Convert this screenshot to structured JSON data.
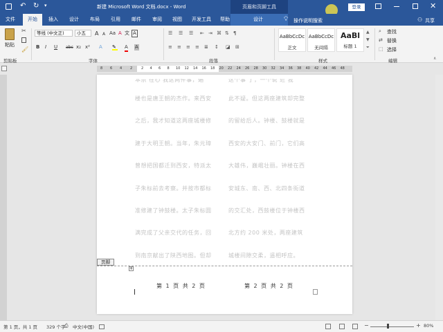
{
  "title_bar": {
    "doc_title": "新建 Microsoft Word 文档.docx  -  Word",
    "context_title": "页眉和页脚工具",
    "login_label": "登录",
    "icons": [
      "save-icon",
      "undo-icon",
      "redo-icon",
      "customize-qat-icon",
      "ribbon-display-icon",
      "minimize-icon",
      "restore-icon",
      "close-icon"
    ]
  },
  "tabs": [
    "文件",
    "开始",
    "插入",
    "设计",
    "布局",
    "引用",
    "邮件",
    "审阅",
    "视图",
    "开发工具",
    "帮助"
  ],
  "active_tab": "开始",
  "context_tab": "设计",
  "tell_me": "操作说明搜索",
  "share": "共享",
  "ribbon": {
    "clipboard": {
      "paste": "粘贴",
      "label": "剪贴板"
    },
    "font": {
      "name": "等线 (中文正)",
      "size": "小五",
      "label": "字体",
      "bold": "B",
      "italic": "I",
      "underline": "U",
      "strike": "abc",
      "sub": "x₂",
      "sup": "x²",
      "clear": "A",
      "grow": "A",
      "shrink": "A",
      "aa": "Aa",
      "wen": "文",
      "color_a": "A",
      "a_box": "A"
    },
    "paragraph": {
      "label": "段落"
    },
    "styles": {
      "label": "样式",
      "items": [
        {
          "preview": "AaBbCcDc",
          "name": "正文"
        },
        {
          "preview": "AaBbCcDc",
          "name": "无间隔"
        },
        {
          "preview": "AaBl",
          "name": "标题 1"
        }
      ]
    },
    "editing": {
      "find": "查找",
      "replace": "替换",
      "select": "选择",
      "label": "编辑"
    }
  },
  "ruler": {
    "left_numbers": [
      "8",
      "6",
      "4",
      "2"
    ],
    "right_numbers": [
      "2",
      "4",
      "6",
      "8",
      "10",
      "12",
      "14",
      "16",
      "18",
      "20",
      "22",
      "24",
      "26",
      "28",
      "30",
      "32",
      "34",
      "36",
      "38",
      "40",
      "42",
      "44",
      "46",
      "48"
    ]
  },
  "document": {
    "col1": [
      "楼也是唐王朝的杰作。来西安",
      "之后，我才知道这两座城楼修",
      "建于大明王朝。当年，朱元璋",
      "曾想把国都迁到西安，特派太",
      "子朱标前去考察。并按市都标",
      "准修建了钟鼓楼。太子朱标圆",
      "满完成了父亲交代的任务，回",
      "到南京献出了陕西地图。但却"
    ],
    "col2": [
      "此不疑。但这两座建筑却完整",
      "的留给后人。钟楼、鼓楼就是",
      "西安的大安门、前门，它们高",
      "大雄伟，巍峨壮丽。钟楼在西",
      "安城东、南、西、北四条街道",
      "的交汇处，西鼓楼位于钟楼西",
      "北方约 200 米处，两座建筑",
      "城楼间隙交柔，遥相呼应。"
    ],
    "partial_top": [
      "本宗 在心   我这两件事，遍",
      "这个事   了，一个说 近 我"
    ],
    "footer_tag": "页脚",
    "footer_left": "第 1 页  共 2 页",
    "footer_right": "第 2 页  共 2 页"
  },
  "status": {
    "page": "第 1 页，共 1 页",
    "words": "329 个字",
    "lang": "中文(中国)",
    "zoom": "80%",
    "zoom_level_percent": 80
  }
}
